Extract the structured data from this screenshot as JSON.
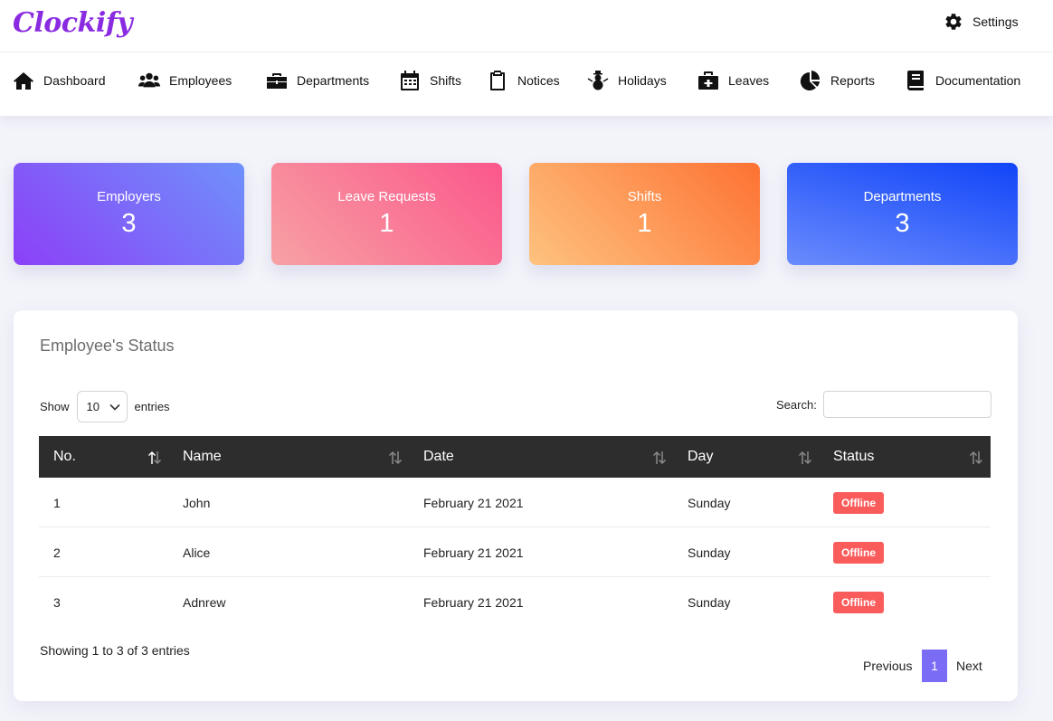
{
  "app": {
    "logo": "Clockify"
  },
  "topbar": {
    "settings_label": "Settings"
  },
  "nav": {
    "items": [
      {
        "label": "Dashboard",
        "icon": "home-icon"
      },
      {
        "label": "Employees",
        "icon": "users-icon"
      },
      {
        "label": "Departments",
        "icon": "briefcase-icon"
      },
      {
        "label": "Shifts",
        "icon": "calendar-icon"
      },
      {
        "label": "Notices",
        "icon": "clipboard-icon"
      },
      {
        "label": "Holidays",
        "icon": "snowman-icon"
      },
      {
        "label": "Leaves",
        "icon": "medkit-icon"
      },
      {
        "label": "Reports",
        "icon": "pie-chart-icon"
      },
      {
        "label": "Documentation",
        "icon": "book-icon"
      }
    ]
  },
  "stats": [
    {
      "label": "Employers",
      "value": "3"
    },
    {
      "label": "Leave Requests",
      "value": "1"
    },
    {
      "label": "Shifts",
      "value": "1"
    },
    {
      "label": "Departments",
      "value": "3"
    }
  ],
  "status_panel": {
    "title": "Employee's Status",
    "show_label": "Show",
    "entries_value": "10",
    "entries_label": "entries",
    "search_label": "Search:",
    "search_value": "",
    "columns": [
      "No.",
      "Name",
      "Date",
      "Day",
      "Status"
    ],
    "rows": [
      {
        "no": "1",
        "name": "John",
        "date": "February 21 2021",
        "day": "Sunday",
        "status": "Offline"
      },
      {
        "no": "2",
        "name": "Alice",
        "date": "February 21 2021",
        "day": "Sunday",
        "status": "Offline"
      },
      {
        "no": "3",
        "name": "Adnrew",
        "date": "February 21 2021",
        "day": "Sunday",
        "status": "Offline"
      }
    ],
    "info": "Showing 1 to 3 of 3 entries",
    "pagination": {
      "previous": "Previous",
      "current": "1",
      "next": "Next"
    }
  },
  "colors": {
    "brand": "#8a2be2",
    "offline_badge": "#fa5c5c",
    "pager_active": "#7b6cf6",
    "table_header": "#2d2d2d"
  }
}
